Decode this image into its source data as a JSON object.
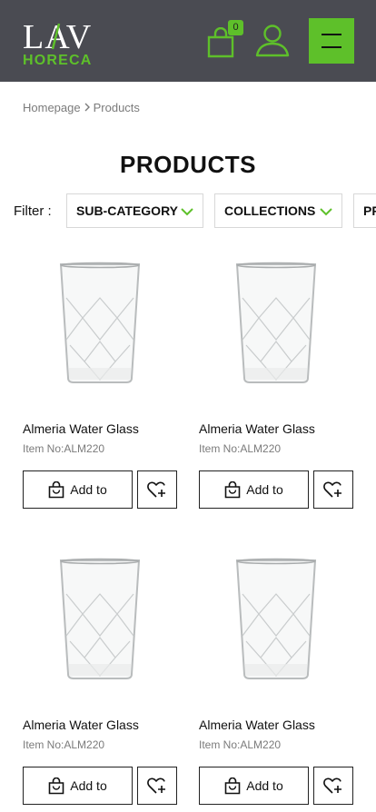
{
  "header": {
    "logo_top": "LAV",
    "logo_bottom": "HORECA",
    "cart_count": "0",
    "icons": {
      "cart": "shopping-bag-icon",
      "user": "user-icon",
      "menu": "hamburger-menu-icon"
    },
    "colors": {
      "background": "#4a4b52",
      "accent": "#5ec02a"
    }
  },
  "breadcrumb": {
    "home": "Homepage",
    "current": "Products"
  },
  "page_title": "PRODUCTS",
  "filters": {
    "label": "Filter :",
    "buttons": [
      "SUB-CATEGORY",
      "COLLECTIONS",
      "PRODUCT TYPE"
    ]
  },
  "products": [
    {
      "name": "Almeria Water Glass",
      "sku": "Item No:ALM220",
      "add_label": "Add to"
    },
    {
      "name": "Almeria Water Glass",
      "sku": "Item No:ALM220",
      "add_label": "Add to"
    },
    {
      "name": "Almeria Water Glass",
      "sku": "Item No:ALM220",
      "add_label": "Add to"
    },
    {
      "name": "Almeria Water Glass",
      "sku": "Item No:ALM220",
      "add_label": "Add to"
    }
  ]
}
